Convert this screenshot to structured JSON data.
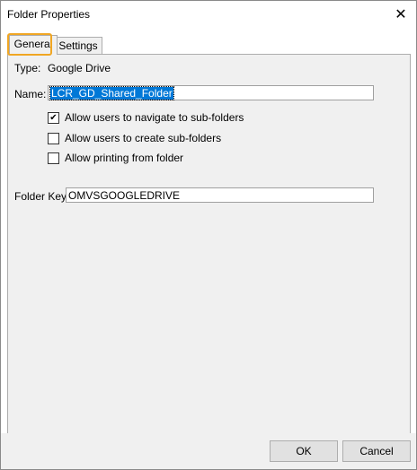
{
  "window": {
    "title": "Folder Properties",
    "close_glyph": "✕"
  },
  "tabs": [
    {
      "label": "General",
      "active": true
    },
    {
      "label": "Settings",
      "active": false
    }
  ],
  "general": {
    "type_label": "Type:",
    "type_value": "Google Drive",
    "name_label": "Name:",
    "name_value": "LCR_GD_Shared_Folder",
    "checkboxes": [
      {
        "label": "Allow users to navigate to sub-folders",
        "checked": true
      },
      {
        "label": "Allow users to create sub-folders",
        "checked": false
      },
      {
        "label": "Allow printing from folder",
        "checked": false
      }
    ],
    "folder_key_label": "Folder Key:",
    "folder_key_value": "OMVSGOOGLEDRIVE"
  },
  "buttons": {
    "ok": "OK",
    "cancel": "Cancel"
  },
  "colors": {
    "highlight": "#f0a623",
    "selection": "#0078d7"
  },
  "icons": {
    "check": "✔"
  }
}
